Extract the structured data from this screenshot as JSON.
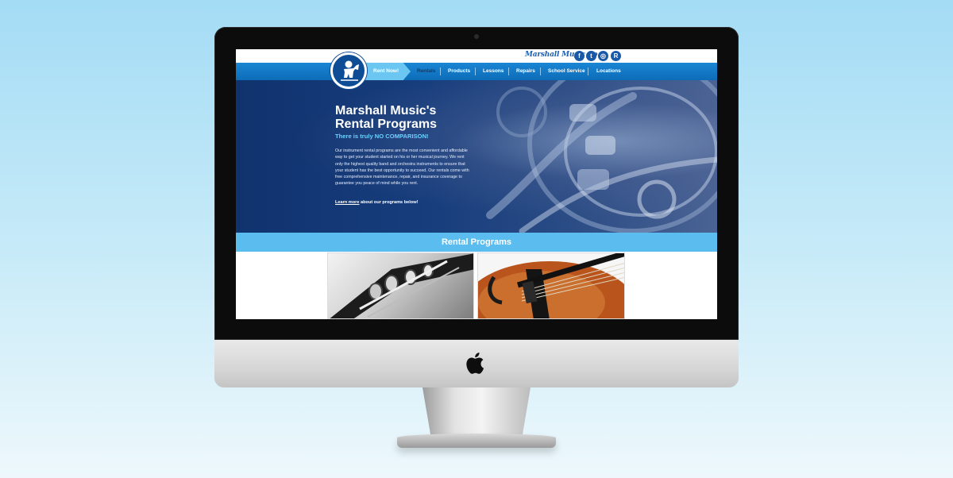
{
  "site": {
    "brand_script": "Marshall Music Co.",
    "social_icons": [
      {
        "name": "facebook-icon",
        "glyph": "f"
      },
      {
        "name": "twitter-icon",
        "glyph": "t"
      },
      {
        "name": "instagram-icon",
        "glyph": "◎"
      },
      {
        "name": "reverb-icon",
        "glyph": "R"
      }
    ]
  },
  "nav": {
    "rent_now": "Rent Now!",
    "items": [
      "Rentals",
      "Products",
      "Lessons",
      "Repairs",
      "School Service",
      "Locations"
    ],
    "active_index": 0
  },
  "hero": {
    "title_line1": "Marshall Music's",
    "title_line2": "Rental Programs",
    "subtitle": "There is truly NO COMPARISON!",
    "body": "Our instrument rental programs are the most convenient and affordable way to get your student started on his or her musical journey. We rent only the highest quality band and orchestra instruments to ensure that your student has the best opportunity to succeed. Our rentals come with free comprehensive maintenance, repair, and insurance coverage to guarantee you peace of mind while you rent.",
    "learn_more_link": "Learn more",
    "learn_more_rest": " about our programs below!"
  },
  "section": {
    "title": "Rental Programs"
  },
  "colors": {
    "nav_blue": "#0d6cb8",
    "accent_light_blue": "#5bbcf0",
    "hero_navy": "#10336e",
    "background_sky": "#a4dcf5"
  }
}
